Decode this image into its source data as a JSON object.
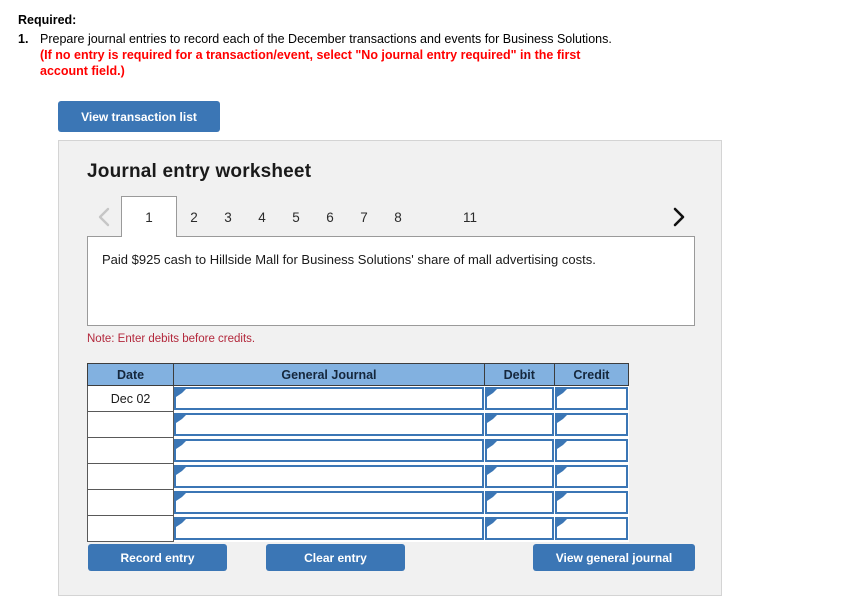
{
  "required": {
    "heading": "Required:",
    "item_number": "1.",
    "instruction": "Prepare journal entries to record each of the December transactions and events for Business Solutions.",
    "note_red": "(If no entry is required for a transaction/event, select \"No journal entry required\" in the first account field.)"
  },
  "toolbar": {
    "view_transaction_list_label": "View transaction list"
  },
  "worksheet": {
    "title": "Journal entry worksheet",
    "tabs": [
      {
        "label": "1",
        "active": true,
        "gap": false
      },
      {
        "label": "2",
        "active": false,
        "gap": false
      },
      {
        "label": "3",
        "active": false,
        "gap": false
      },
      {
        "label": "4",
        "active": false,
        "gap": false
      },
      {
        "label": "5",
        "active": false,
        "gap": false
      },
      {
        "label": "6",
        "active": false,
        "gap": false
      },
      {
        "label": "7",
        "active": false,
        "gap": false
      },
      {
        "label": "8",
        "active": false,
        "gap": false
      },
      {
        "label": "11",
        "active": false,
        "gap": true
      }
    ],
    "prev_icon": "chevron-left-icon",
    "next_icon": "chevron-right-icon",
    "transaction_description": "Paid $925 cash to Hillside Mall for Business Solutions' share of mall advertising costs.",
    "note": "Note: Enter debits before credits."
  },
  "journal": {
    "columns": [
      "Date",
      "General Journal",
      "Debit",
      "Credit"
    ],
    "rows": [
      {
        "date": "Dec 02",
        "general_journal": "",
        "debit": "",
        "credit": ""
      },
      {
        "date": "",
        "general_journal": "",
        "debit": "",
        "credit": ""
      },
      {
        "date": "",
        "general_journal": "",
        "debit": "",
        "credit": ""
      },
      {
        "date": "",
        "general_journal": "",
        "debit": "",
        "credit": ""
      },
      {
        "date": "",
        "general_journal": "",
        "debit": "",
        "credit": ""
      },
      {
        "date": "",
        "general_journal": "",
        "debit": "",
        "credit": ""
      }
    ]
  },
  "actions": {
    "record_entry_label": "Record entry",
    "clear_entry_label": "Clear entry",
    "view_general_journal_label": "View general journal"
  },
  "colors": {
    "accent_blue": "#3b76b5",
    "header_blue": "#82b1e0",
    "panel_gray": "#f1f1f1",
    "alert_red": "#ff0000",
    "note_red": "#b3283c"
  }
}
